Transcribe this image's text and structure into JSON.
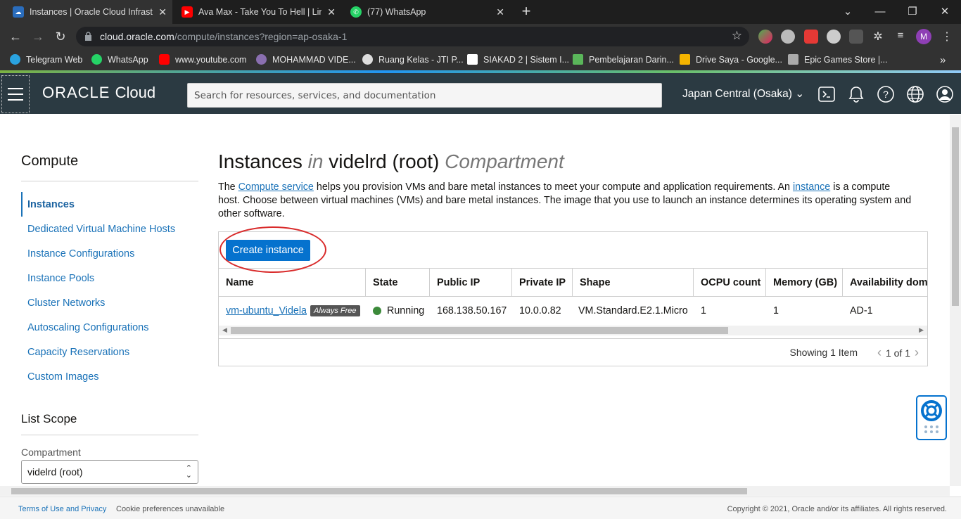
{
  "browser": {
    "tabs": [
      {
        "title": "Instances | Oracle Cloud Infrastru",
        "icon": "oracle-cloud-icon"
      },
      {
        "title": "Ava Max - Take You To Hell | Lirik",
        "icon": "youtube-icon"
      },
      {
        "title": "(77) WhatsApp",
        "icon": "whatsapp-icon"
      }
    ],
    "url_host": "cloud.oracle.com",
    "url_path": "/compute/instances?region=ap-osaka-1",
    "profile_initial": "M",
    "bookmarks": [
      {
        "label": "Telegram Web",
        "color": "#2aa3e0"
      },
      {
        "label": "WhatsApp",
        "color": "#25d366"
      },
      {
        "label": "www.youtube.com",
        "color": "#ff0000"
      },
      {
        "label": "MOHAMMAD VIDE...",
        "color": "#8a6fb0"
      },
      {
        "label": "Ruang Kelas - JTI P...",
        "color": "#dddddd"
      },
      {
        "label": "SIAKAD 2 | Sistem I...",
        "color": "#ffffff"
      },
      {
        "label": "Pembelajaran Darin...",
        "color": "#5ab65a"
      },
      {
        "label": "Drive Saya - Google...",
        "color": "#f4b400"
      },
      {
        "label": "Epic Games Store |...",
        "color": "#aaaaaa"
      }
    ]
  },
  "header": {
    "logo_brand": "ORACLE",
    "logo_product": "Cloud",
    "search_placeholder": "Search for resources, services, and documentation",
    "region": "Japan Central (Osaka)"
  },
  "sidebar": {
    "title": "Compute",
    "items": [
      {
        "label": "Instances",
        "active": true
      },
      {
        "label": "Dedicated Virtual Machine Hosts"
      },
      {
        "label": "Instance Configurations"
      },
      {
        "label": "Instance Pools"
      },
      {
        "label": "Cluster Networks"
      },
      {
        "label": "Autoscaling Configurations"
      },
      {
        "label": "Capacity Reservations"
      },
      {
        "label": "Custom Images"
      }
    ],
    "scope_title": "List Scope",
    "compartment_label": "Compartment",
    "compartment_value": "videlrd (root)"
  },
  "main": {
    "title_a": "Instances",
    "title_in": "in",
    "title_b": "videlrd (root)",
    "title_c": "Compartment",
    "desc_1": "The ",
    "desc_link1": "Compute service",
    "desc_2": " helps you provision VMs and bare metal instances to meet your compute and application requirements. An ",
    "desc_link2": "instance",
    "desc_3": " is a compute host. Choose between virtual machines (VMs) and bare metal instances. The image that you use to launch an instance determines its operating system and other software.",
    "create_button": "Create instance",
    "columns": [
      "Name",
      "State",
      "Public IP",
      "Private IP",
      "Shape",
      "OCPU count",
      "Memory (GB)",
      "Availability doma"
    ],
    "rows": [
      {
        "name": "vm-ubuntu_Videla",
        "badge": "Always Free",
        "state": "Running",
        "public_ip": "168.138.50.167",
        "private_ip": "10.0.0.82",
        "shape": "VM.Standard.E2.1.Micro",
        "ocpu": "1",
        "memory": "1",
        "ad": "AD-1"
      }
    ],
    "showing": "Showing 1 Item",
    "pager": "1 of 1"
  },
  "footer": {
    "terms": "Terms of Use and Privacy",
    "cookies": "Cookie preferences unavailable",
    "copyright": "Copyright © 2021, Oracle and/or its affiliates. All rights reserved."
  }
}
